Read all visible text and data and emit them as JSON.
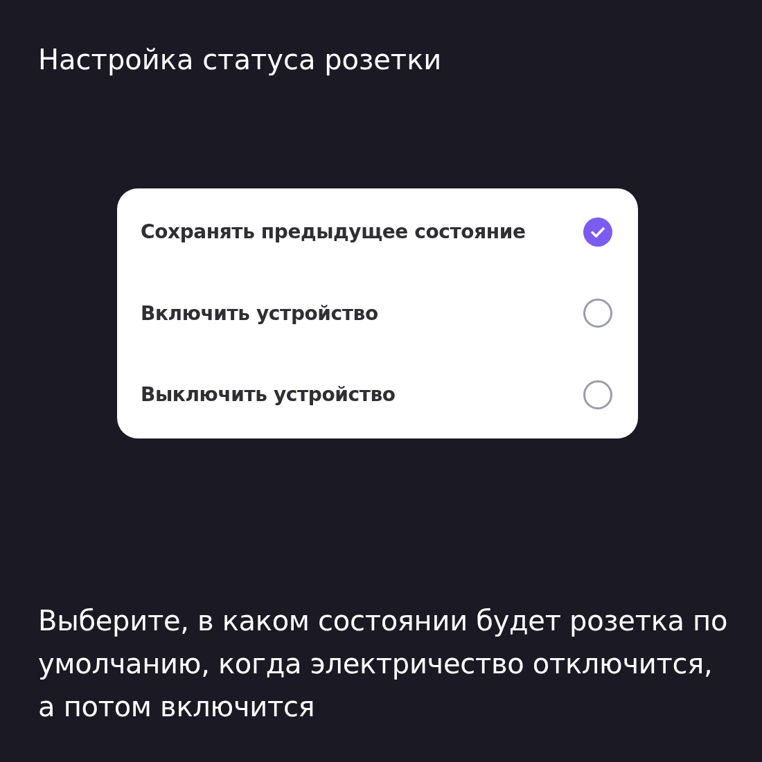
{
  "title": "Настройка статуса розетки",
  "options": [
    {
      "label": "Сохранять предыдущее состояние",
      "selected": true
    },
    {
      "label": "Включить устройство",
      "selected": false
    },
    {
      "label": "Выключить устройство",
      "selected": false
    }
  ],
  "description": "Выберите, в каком состоянии будет розетка по умолчанию, когда электричество отключится, а потом включится"
}
